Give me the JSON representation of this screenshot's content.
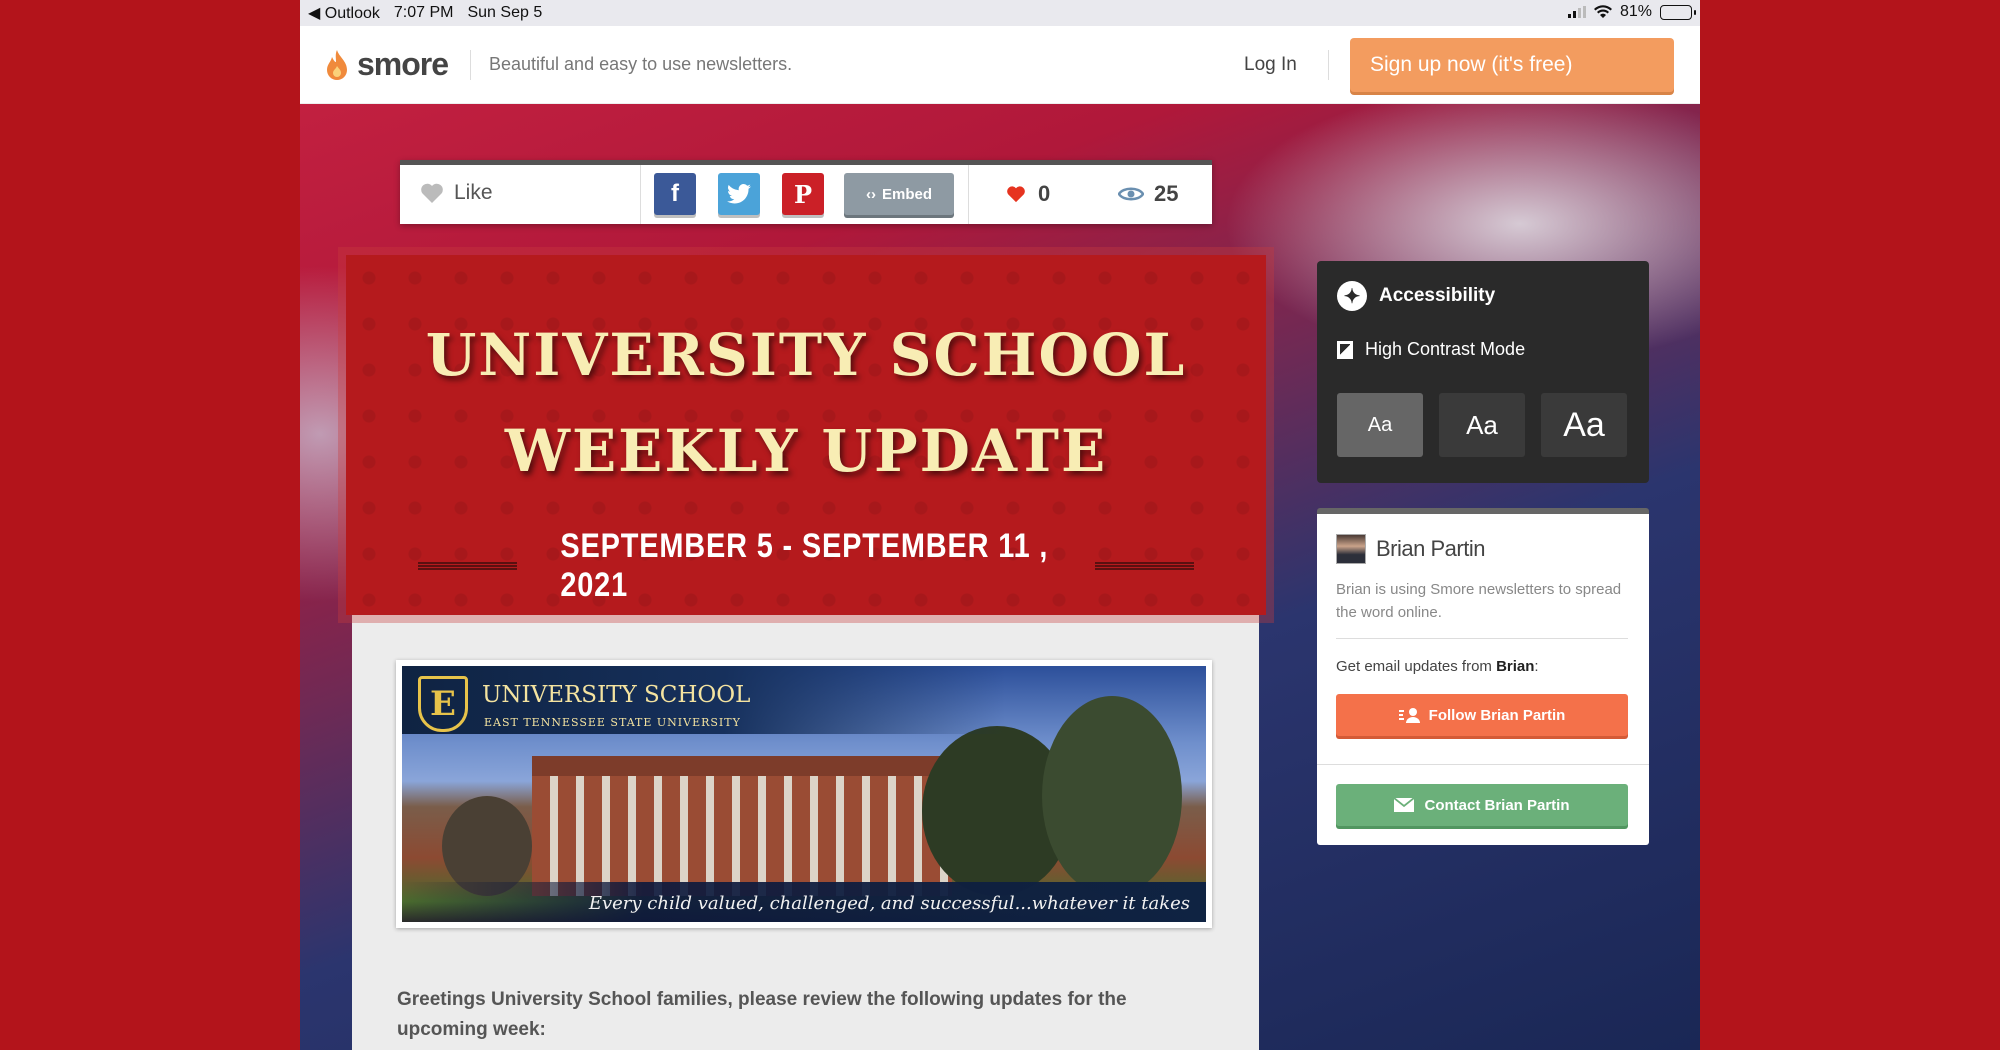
{
  "status_bar": {
    "back_app": "◀ Outlook",
    "time": "7:07 PM",
    "date": "Sun Sep 5",
    "battery": "81%"
  },
  "header": {
    "logo_text": "smore",
    "tagline": "Beautiful and easy to use newsletters.",
    "login": "Log In",
    "signup": "Sign up now (it's free)"
  },
  "social": {
    "like_label": "Like",
    "facebook": "f",
    "pinterest": "P",
    "embed_label": "Embed",
    "likes": "0",
    "views": "25"
  },
  "newsletter": {
    "title_line1": "UNIVERSITY SCHOOL",
    "title_line2": "WEEKLY UPDATE",
    "dates": "SEPTEMBER 5 - SEPTEMBER 11 , 2021",
    "photo": {
      "seal_letter": "E",
      "school": "UNIVERSITY SCHOOL",
      "subtitle": "EAST TENNESSEE STATE UNIVERSITY",
      "caption": "Every child valued, challenged, and successful...whatever it takes"
    },
    "greeting": "Greetings University School families, please review the following updates for the upcoming week:"
  },
  "accessibility": {
    "title": "Accessibility",
    "high_contrast": "High Contrast Mode",
    "sizes": [
      "Aa",
      "Aa",
      "Aa"
    ]
  },
  "author": {
    "name": "Brian Partin",
    "description": "Brian is using Smore newsletters to spread the word online.",
    "updates_prefix": "Get email updates from ",
    "updates_name": "Brian",
    "updates_suffix": ":",
    "follow": "Follow Brian Partin",
    "contact": "Contact Brian Partin"
  },
  "colors": {
    "page_background": "#b3141b",
    "signup": "#f39c5f",
    "follow": "#f4714a",
    "contact": "#6bb07a",
    "banner": "#b51a1d",
    "banner_text": "#f8edb4"
  }
}
